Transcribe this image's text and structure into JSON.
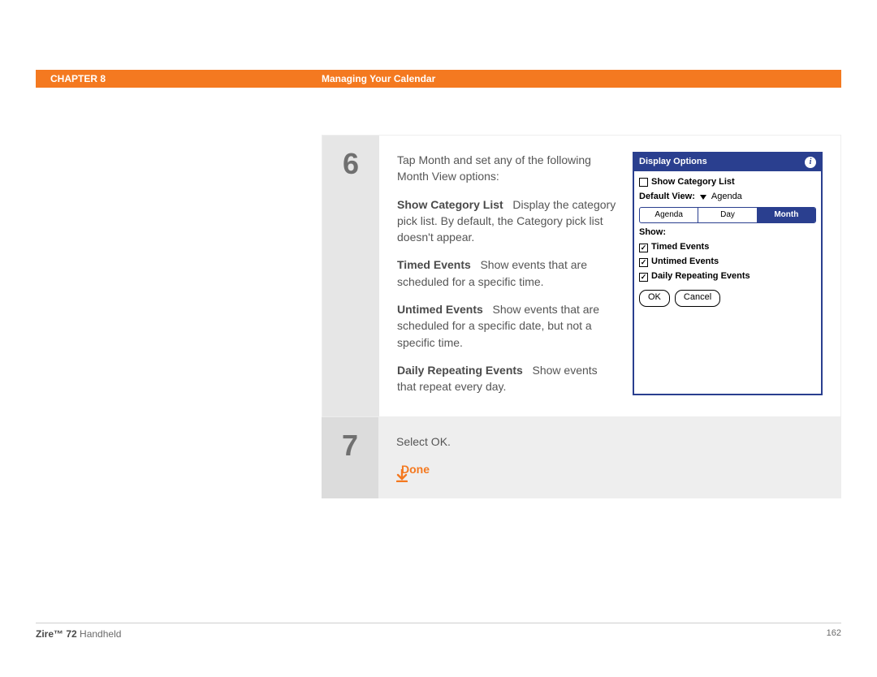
{
  "header": {
    "chapter": "CHAPTER 8",
    "section": "Managing Your Calendar"
  },
  "steps": {
    "s6": {
      "number": "6",
      "intro": "Tap Month and set any of the following Month View options:",
      "items": [
        {
          "lead": "Show Category List",
          "text": "Display the category pick list. By default, the Category pick list doesn't appear."
        },
        {
          "lead": "Timed Events",
          "text": "Show events that are scheduled for a specific time."
        },
        {
          "lead": "Untimed Events",
          "text": "Show events that are scheduled for a specific date, but not a specific time."
        },
        {
          "lead": "Daily Repeating Events",
          "text": "Show events that repeat every day."
        }
      ]
    },
    "s7": {
      "number": "7",
      "text": "Select OK.",
      "done": "Done"
    }
  },
  "palm": {
    "title": "Display Options",
    "show_category": "Show Category List",
    "default_view_label": "Default View:",
    "default_view_value": "Agenda",
    "tabs": [
      "Agenda",
      "Day",
      "Month"
    ],
    "active_tab": "Month",
    "show_label": "Show:",
    "options": [
      "Timed Events",
      "Untimed Events",
      "Daily Repeating Events"
    ],
    "buttons": {
      "ok": "OK",
      "cancel": "Cancel"
    }
  },
  "footer": {
    "product_bold": "Zire™ 72",
    "product_rest": " Handheld",
    "page": "162"
  }
}
